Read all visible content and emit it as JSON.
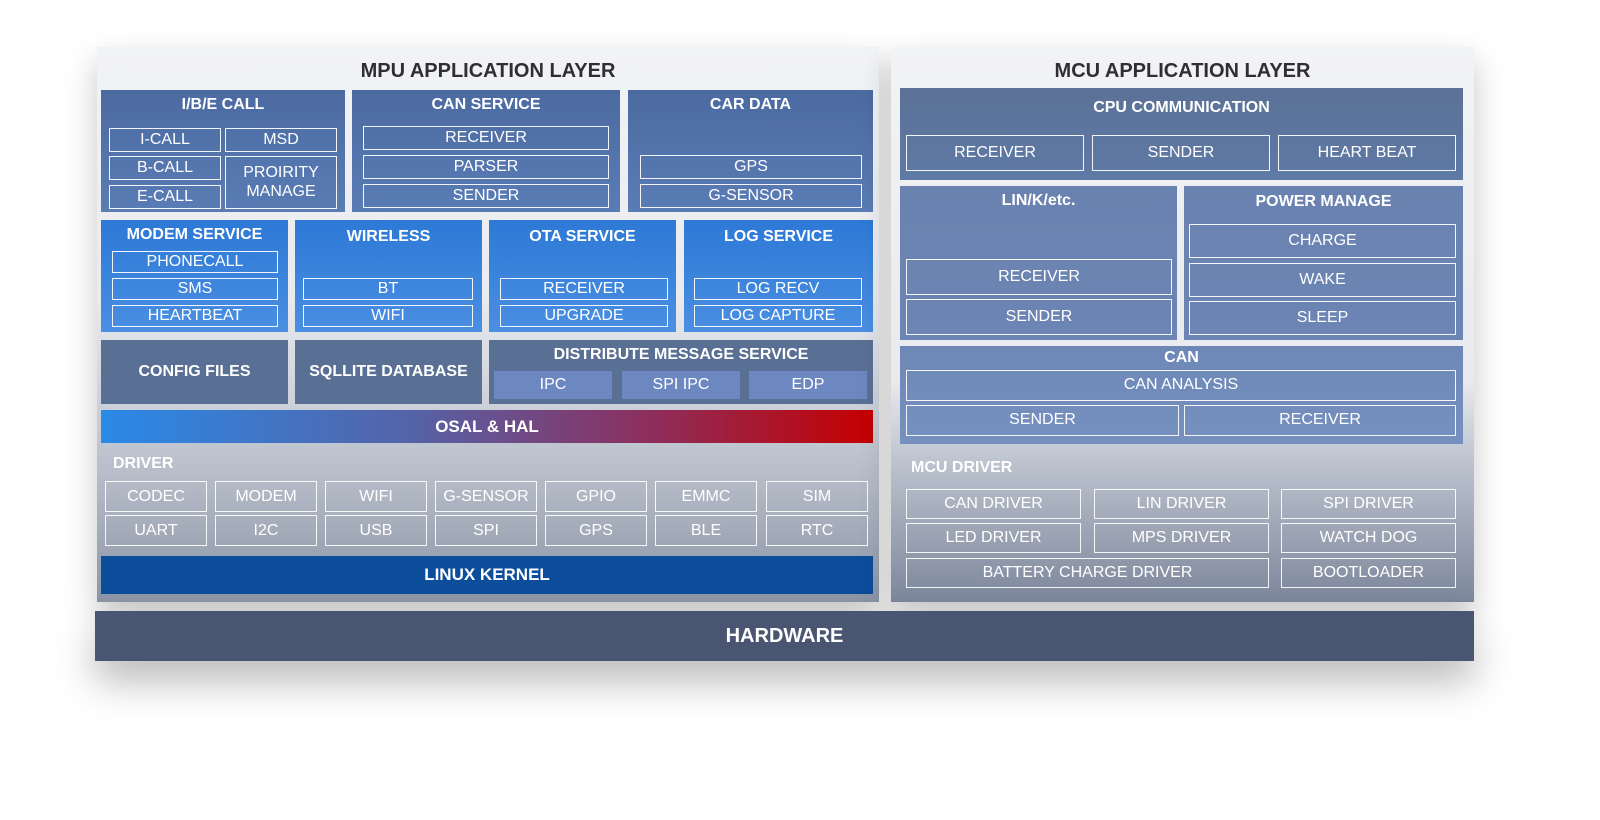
{
  "mpu": {
    "title": "MPU APPLICATION LAYER",
    "ibe_call": {
      "title": "I/B/E CALL",
      "i_call": "I-CALL",
      "b_call": "B-CALL",
      "e_call": "E-CALL",
      "msd": "MSD",
      "priority_manage": "PROIRITY MANAGE"
    },
    "can_service": {
      "title": "CAN SERVICE",
      "receiver": "RECEIVER",
      "parser": "PARSER",
      "sender": "SENDER"
    },
    "car_data": {
      "title": "CAR DATA",
      "gps": "GPS",
      "g_sensor": "G-SENSOR"
    },
    "modem_service": {
      "title": "MODEM SERVICE",
      "phonecall": "PHONECALL",
      "sms": "SMS",
      "heartbeat": "HEARTBEAT"
    },
    "wireless": {
      "title": "WIRELESS",
      "bt": "BT",
      "wifi": "WIFI"
    },
    "ota_service": {
      "title": "OTA SERVICE",
      "receiver": "RECEIVER",
      "upgrade": "UPGRADE"
    },
    "log_service": {
      "title": "LOG SERVICE",
      "log_recv": "LOG RECV",
      "log_capture": "LOG CAPTURE"
    },
    "config_files": "CONFIG FILES",
    "sqllite_database": "SQLLITE DATABASE",
    "distribute_message_service": {
      "title": "DISTRIBUTE MESSAGE SERVICE",
      "ipc": "IPC",
      "spi_ipc": "SPI IPC",
      "edp": "EDP"
    },
    "osal_hal": "OSAL & HAL",
    "driver": {
      "title": "DRIVER",
      "row1": [
        "CODEC",
        "MODEM",
        "WIFI",
        "G-SENSOR",
        "GPIO",
        "EMMC",
        "SIM"
      ],
      "row2": [
        "UART",
        "I2C",
        "USB",
        "SPI",
        "GPS",
        "BLE",
        "RTC"
      ]
    },
    "linux_kernel": "LINUX KERNEL"
  },
  "mcu": {
    "title": "MCU APPLICATION LAYER",
    "cpu_communication": {
      "title": "CPU COMMUNICATION",
      "receiver": "RECEIVER",
      "sender": "SENDER",
      "heart_beat": "HEART BEAT"
    },
    "lin_k": {
      "title": "LIN/K/etc.",
      "receiver": "RECEIVER",
      "sender": "SENDER"
    },
    "power_manage": {
      "title": "POWER MANAGE",
      "charge": "CHARGE",
      "wake": "WAKE",
      "sleep": "SLEEP"
    },
    "can": {
      "title": "CAN",
      "can_analysis": "CAN ANALYSIS",
      "sender": "SENDER",
      "receiver": "RECEIVER"
    },
    "mcu_driver": {
      "title": "MCU DRIVER",
      "can_driver": "CAN DRIVER",
      "lin_driver": "LIN DRIVER",
      "spi_driver": "SPI DRIVER",
      "led_driver": "LED DRIVER",
      "mps_driver": "MPS DRIVER",
      "watch_dog": "WATCH DOG",
      "battery_charge_driver": "BATTERY CHARGE DRIVER",
      "bootloader": "BOOTLOADER"
    }
  },
  "hardware": "HARDWARE"
}
